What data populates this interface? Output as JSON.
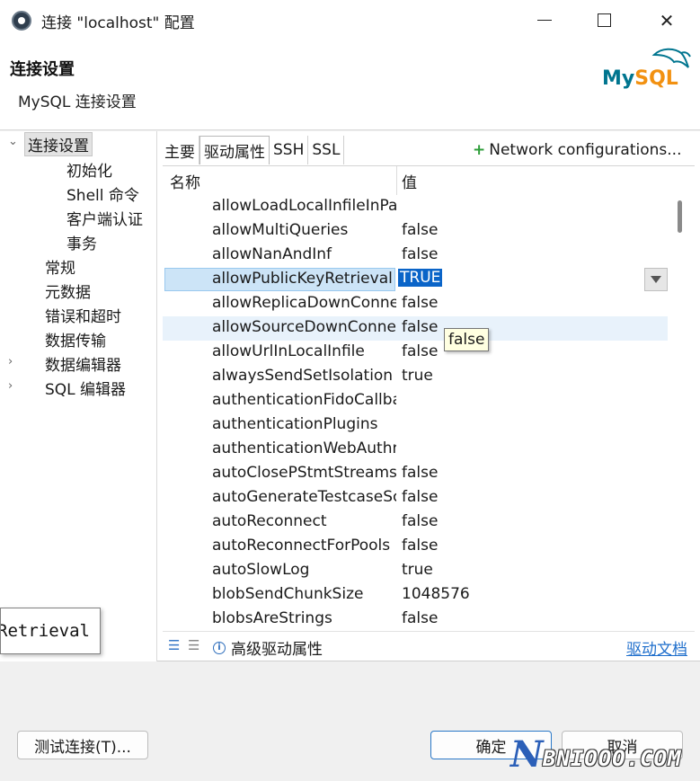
{
  "window": {
    "title": "连接 \"localhost\" 配置",
    "controls": [
      "minimize",
      "maximize",
      "close"
    ]
  },
  "header": {
    "title": "连接设置",
    "subtitle": "MySQL 连接设置",
    "logo": {
      "part1": "My",
      "part2": "SQL"
    }
  },
  "nav": {
    "items": [
      {
        "label": "连接设置",
        "level": 0,
        "expanded": true,
        "selected": true
      },
      {
        "label": "初始化",
        "level": 1
      },
      {
        "label": "Shell 命令",
        "level": 1
      },
      {
        "label": "客户端认证",
        "level": 1
      },
      {
        "label": "事务",
        "level": 1
      },
      {
        "label": "常规",
        "level": 0
      },
      {
        "label": "元数据",
        "level": 0
      },
      {
        "label": "错误和超时",
        "level": 0
      },
      {
        "label": "数据传输",
        "level": 0
      },
      {
        "label": "数据编辑器",
        "level": 0,
        "collapsed": true
      },
      {
        "label": "SQL 编辑器",
        "level": 0,
        "collapsed": true
      }
    ]
  },
  "tabs": [
    {
      "label": "主要"
    },
    {
      "label": "驱动属性",
      "active": true
    },
    {
      "label": "SSH"
    },
    {
      "label": "SSL"
    }
  ],
  "network_config": {
    "plus": "+",
    "label": "Network configurations..."
  },
  "table": {
    "columns": [
      "名称",
      "值"
    ],
    "rows": [
      {
        "name": "allowLoadLocalInfileInPath",
        "value": ""
      },
      {
        "name": "allowMultiQueries",
        "value": "false"
      },
      {
        "name": "allowNanAndInf",
        "value": "false"
      },
      {
        "name": "allowPublicKeyRetrieval",
        "value": "TRUE",
        "editing": true
      },
      {
        "name": "allowReplicaDownConnections",
        "value": "false"
      },
      {
        "name": "allowSourceDownConnections",
        "value": "false",
        "hover": true
      },
      {
        "name": "allowUrlInLocalInfile",
        "value": "false"
      },
      {
        "name": "alwaysSendSetIsolation",
        "value": "true"
      },
      {
        "name": "authenticationFidoCallbackHandler",
        "value": ""
      },
      {
        "name": "authenticationPlugins",
        "value": ""
      },
      {
        "name": "authenticationWebAuthnCallbackHandler",
        "value": ""
      },
      {
        "name": "autoClosePStmtStreams",
        "value": "false"
      },
      {
        "name": "autoGenerateTestcaseScript",
        "value": "false"
      },
      {
        "name": "autoReconnect",
        "value": "false"
      },
      {
        "name": "autoReconnectForPools",
        "value": "false"
      },
      {
        "name": "autoSlowLog",
        "value": "true"
      },
      {
        "name": "blobSendChunkSize",
        "value": "1048576"
      },
      {
        "name": "blobsAreStrings",
        "value": "false"
      }
    ]
  },
  "tooltip": "false",
  "drag_ghost": "Retrieval",
  "bottom_bar": {
    "info_label": "高级驱动属性",
    "doc_link": "驱动文档"
  },
  "buttons": {
    "test": "测试连接(T)...",
    "ok": "确定",
    "cancel": "取消"
  },
  "watermark": {
    "n": "N",
    "rest": "BNIOOO.COM"
  }
}
